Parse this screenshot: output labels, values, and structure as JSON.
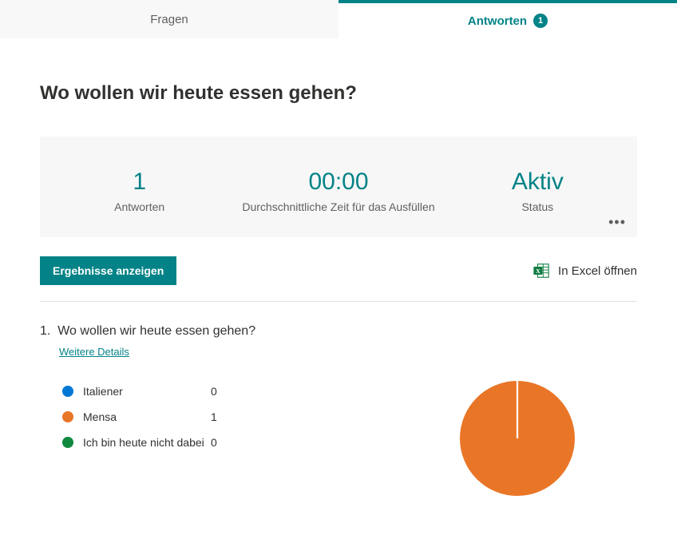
{
  "tabs": {
    "questions": "Fragen",
    "responses": "Antworten",
    "responses_count": "1"
  },
  "form": {
    "title": "Wo wollen wir heute essen gehen?"
  },
  "stats": {
    "responses": {
      "value": "1",
      "label": "Antworten"
    },
    "avg_time": {
      "value": "00:00",
      "label": "Durchschnittliche Zeit für das Ausfüllen"
    },
    "status": {
      "value": "Aktiv",
      "label": "Status"
    }
  },
  "actions": {
    "view_results": "Ergebnisse anzeigen",
    "open_excel": "In Excel öffnen"
  },
  "question": {
    "number": "1.",
    "text": "Wo wollen wir heute essen gehen?",
    "more_details": "Weitere Details",
    "options": [
      {
        "label": "Italiener",
        "count": "0",
        "color": "#0078d4"
      },
      {
        "label": "Mensa",
        "count": "1",
        "color": "#e97627"
      },
      {
        "label": "Ich bin heute nicht dabei",
        "count": "0",
        "color": "#10893e"
      }
    ]
  },
  "chart_data": {
    "type": "pie",
    "title": "Wo wollen wir heute essen gehen?",
    "categories": [
      "Italiener",
      "Mensa",
      "Ich bin heute nicht dabei"
    ],
    "values": [
      0,
      1,
      0
    ],
    "colors": [
      "#0078d4",
      "#e97627",
      "#10893e"
    ]
  }
}
